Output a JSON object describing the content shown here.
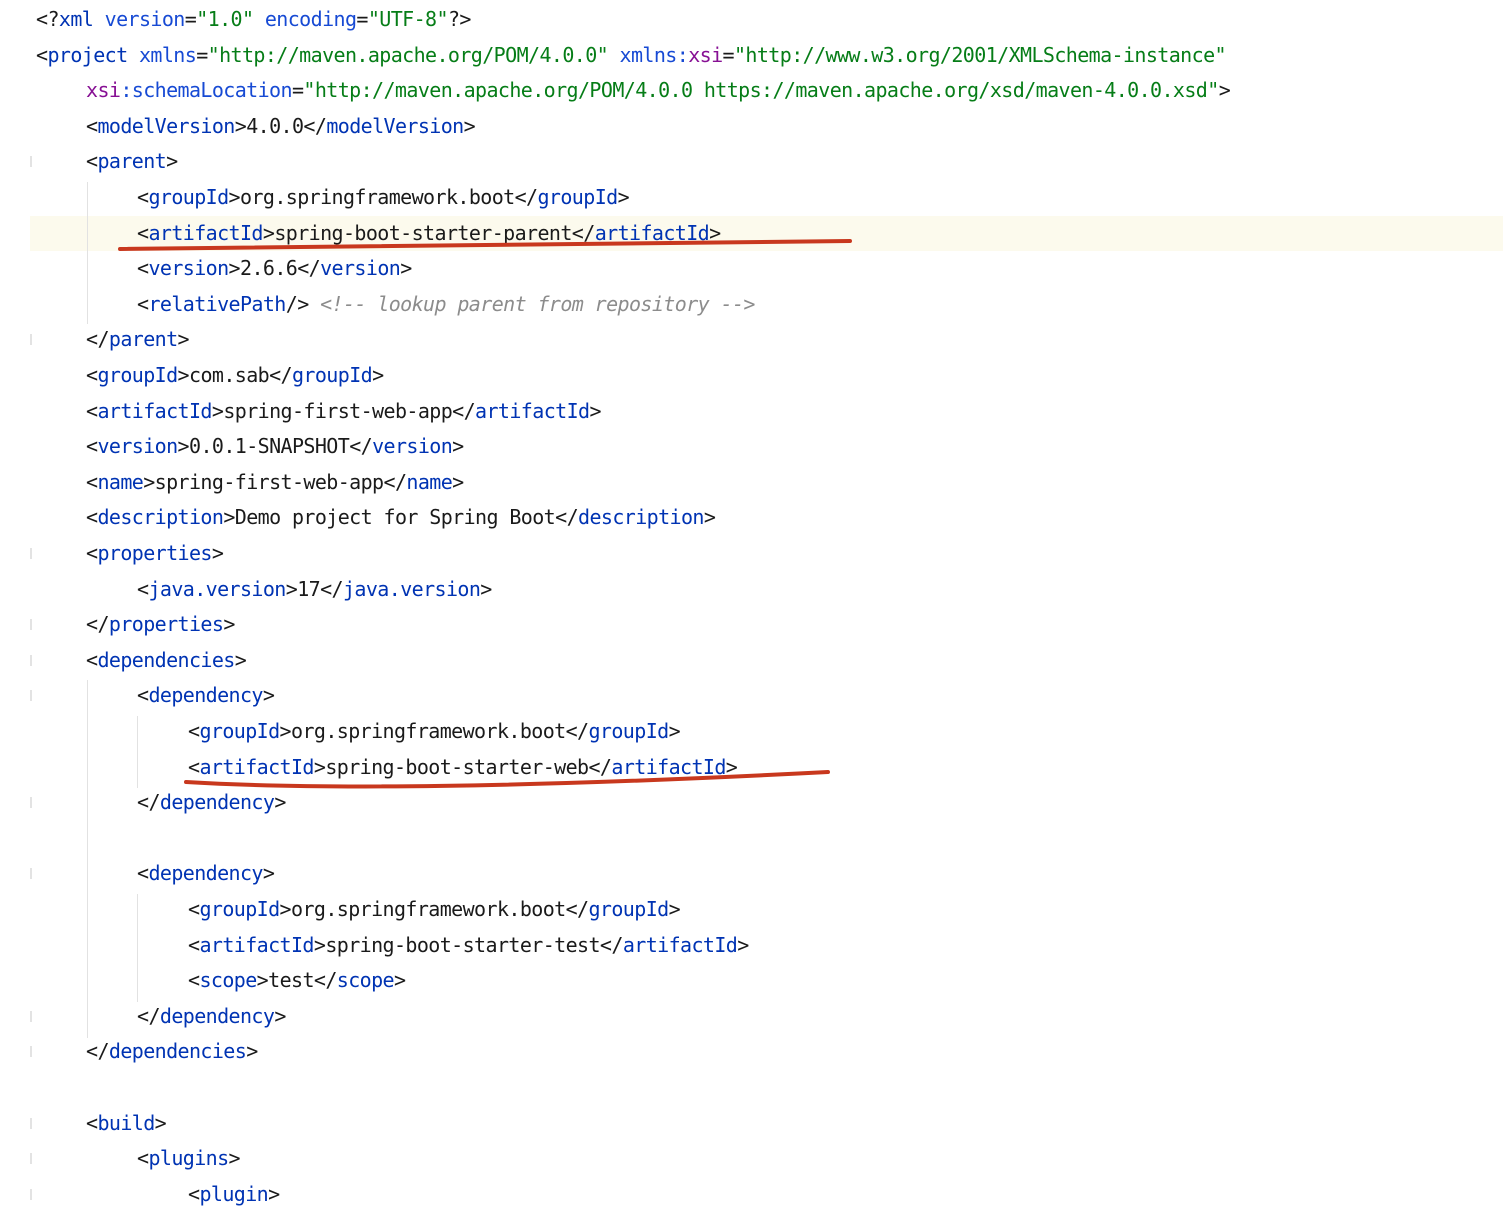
{
  "editor": {
    "current_line": 6,
    "lines": [
      {
        "indent": 0,
        "gutter": false,
        "tokens": [
          [
            "pun",
            "<?"
          ],
          [
            "tag",
            "xml "
          ],
          [
            "attr",
            "version"
          ],
          [
            "pun",
            "="
          ],
          [
            "val",
            "\"1.0\" "
          ],
          [
            "attr",
            "encoding"
          ],
          [
            "pun",
            "="
          ],
          [
            "val",
            "\"UTF-8\""
          ],
          [
            "pun",
            "?>"
          ]
        ]
      },
      {
        "indent": 0,
        "gutter": false,
        "tokens": [
          [
            "pun",
            "<"
          ],
          [
            "tag",
            "project "
          ],
          [
            "attr",
            "xmlns"
          ],
          [
            "pun",
            "="
          ],
          [
            "val",
            "\"http://maven.apache.org/POM/4.0.0\" "
          ],
          [
            "attr",
            "xmlns:"
          ],
          [
            "ns",
            "xsi"
          ],
          [
            "pun",
            "="
          ],
          [
            "val",
            "\"http://www.w3.org/2001/XMLSchema-instance\""
          ]
        ]
      },
      {
        "indent": 1,
        "gutter": false,
        "tokens": [
          [
            "ns",
            "xsi"
          ],
          [
            "attr",
            ":schemaLocation"
          ],
          [
            "pun",
            "="
          ],
          [
            "val",
            "\"http://maven.apache.org/POM/4.0.0 https://maven.apache.org/xsd/maven-4.0.0.xsd\""
          ],
          [
            "pun",
            ">"
          ]
        ]
      },
      {
        "indent": 1,
        "gutter": false,
        "tokens": [
          [
            "pun",
            "<"
          ],
          [
            "tag",
            "modelVersion"
          ],
          [
            "pun",
            ">"
          ],
          [
            "txt",
            "4.0.0"
          ],
          [
            "pun",
            "</"
          ],
          [
            "tag",
            "modelVersion"
          ],
          [
            "pun",
            ">"
          ]
        ]
      },
      {
        "indent": 1,
        "gutter": true,
        "tokens": [
          [
            "pun",
            "<"
          ],
          [
            "tag",
            "parent"
          ],
          [
            "pun",
            ">"
          ]
        ]
      },
      {
        "indent": 2,
        "gutter": false,
        "tokens": [
          [
            "pun",
            "<"
          ],
          [
            "tag",
            "groupId"
          ],
          [
            "pun",
            ">"
          ],
          [
            "txt",
            "org.springframework.boot"
          ],
          [
            "pun",
            "</"
          ],
          [
            "tag",
            "groupId"
          ],
          [
            "pun",
            ">"
          ]
        ]
      },
      {
        "indent": 2,
        "gutter": false,
        "tokens": [
          [
            "pun",
            "<"
          ],
          [
            "tag",
            "artifactId"
          ],
          [
            "pun",
            ">"
          ],
          [
            "txt",
            "spring-boot-starter-parent"
          ],
          [
            "pun",
            "</"
          ],
          [
            "tag",
            "artifactId"
          ],
          [
            "pun",
            ">"
          ]
        ]
      },
      {
        "indent": 2,
        "gutter": false,
        "tokens": [
          [
            "pun",
            "<"
          ],
          [
            "tag",
            "version"
          ],
          [
            "pun",
            ">"
          ],
          [
            "txt",
            "2.6.6"
          ],
          [
            "pun",
            "</"
          ],
          [
            "tag",
            "version"
          ],
          [
            "pun",
            ">"
          ]
        ]
      },
      {
        "indent": 2,
        "gutter": false,
        "tokens": [
          [
            "pun",
            "<"
          ],
          [
            "tag",
            "relativePath"
          ],
          [
            "pun",
            "/> "
          ],
          [
            "cmt",
            "<!-- lookup parent from repository -->"
          ]
        ]
      },
      {
        "indent": 1,
        "gutter": true,
        "tokens": [
          [
            "pun",
            "</"
          ],
          [
            "tag",
            "parent"
          ],
          [
            "pun",
            ">"
          ]
        ]
      },
      {
        "indent": 1,
        "gutter": false,
        "tokens": [
          [
            "pun",
            "<"
          ],
          [
            "tag",
            "groupId"
          ],
          [
            "pun",
            ">"
          ],
          [
            "txt",
            "com.sab"
          ],
          [
            "pun",
            "</"
          ],
          [
            "tag",
            "groupId"
          ],
          [
            "pun",
            ">"
          ]
        ]
      },
      {
        "indent": 1,
        "gutter": false,
        "tokens": [
          [
            "pun",
            "<"
          ],
          [
            "tag",
            "artifactId"
          ],
          [
            "pun",
            ">"
          ],
          [
            "txt",
            "spring-first-web-app"
          ],
          [
            "pun",
            "</"
          ],
          [
            "tag",
            "artifactId"
          ],
          [
            "pun",
            ">"
          ]
        ]
      },
      {
        "indent": 1,
        "gutter": false,
        "tokens": [
          [
            "pun",
            "<"
          ],
          [
            "tag",
            "version"
          ],
          [
            "pun",
            ">"
          ],
          [
            "txt",
            "0.0.1-SNAPSHOT"
          ],
          [
            "pun",
            "</"
          ],
          [
            "tag",
            "version"
          ],
          [
            "pun",
            ">"
          ]
        ]
      },
      {
        "indent": 1,
        "gutter": false,
        "tokens": [
          [
            "pun",
            "<"
          ],
          [
            "tag",
            "name"
          ],
          [
            "pun",
            ">"
          ],
          [
            "txt",
            "spring-first-web-app"
          ],
          [
            "pun",
            "</"
          ],
          [
            "tag",
            "name"
          ],
          [
            "pun",
            ">"
          ]
        ]
      },
      {
        "indent": 1,
        "gutter": false,
        "tokens": [
          [
            "pun",
            "<"
          ],
          [
            "tag",
            "description"
          ],
          [
            "pun",
            ">"
          ],
          [
            "txt",
            "Demo project for Spring Boot"
          ],
          [
            "pun",
            "</"
          ],
          [
            "tag",
            "description"
          ],
          [
            "pun",
            ">"
          ]
        ]
      },
      {
        "indent": 1,
        "gutter": true,
        "tokens": [
          [
            "pun",
            "<"
          ],
          [
            "tag",
            "properties"
          ],
          [
            "pun",
            ">"
          ]
        ]
      },
      {
        "indent": 2,
        "gutter": false,
        "tokens": [
          [
            "pun",
            "<"
          ],
          [
            "tag",
            "java.version"
          ],
          [
            "pun",
            ">"
          ],
          [
            "txt",
            "17"
          ],
          [
            "pun",
            "</"
          ],
          [
            "tag",
            "java.version"
          ],
          [
            "pun",
            ">"
          ]
        ]
      },
      {
        "indent": 1,
        "gutter": true,
        "tokens": [
          [
            "pun",
            "</"
          ],
          [
            "tag",
            "properties"
          ],
          [
            "pun",
            ">"
          ]
        ]
      },
      {
        "indent": 1,
        "gutter": true,
        "tokens": [
          [
            "pun",
            "<"
          ],
          [
            "tag",
            "dependencies"
          ],
          [
            "pun",
            ">"
          ]
        ]
      },
      {
        "indent": 2,
        "gutter": true,
        "tokens": [
          [
            "pun",
            "<"
          ],
          [
            "tag",
            "dependency"
          ],
          [
            "pun",
            ">"
          ]
        ]
      },
      {
        "indent": 3,
        "gutter": false,
        "tokens": [
          [
            "pun",
            "<"
          ],
          [
            "tag",
            "groupId"
          ],
          [
            "pun",
            ">"
          ],
          [
            "txt",
            "org.springframework.boot"
          ],
          [
            "pun",
            "</"
          ],
          [
            "tag",
            "groupId"
          ],
          [
            "pun",
            ">"
          ]
        ]
      },
      {
        "indent": 3,
        "gutter": false,
        "tokens": [
          [
            "pun",
            "<"
          ],
          [
            "tag",
            "artifactId"
          ],
          [
            "pun",
            ">"
          ],
          [
            "txt",
            "spring-boot-starter-web"
          ],
          [
            "pun",
            "</"
          ],
          [
            "tag",
            "artifactId"
          ],
          [
            "pun",
            ">"
          ]
        ]
      },
      {
        "indent": 2,
        "gutter": true,
        "tokens": [
          [
            "pun",
            "</"
          ],
          [
            "tag",
            "dependency"
          ],
          [
            "pun",
            ">"
          ]
        ]
      },
      {
        "indent": 0,
        "gutter": false,
        "tokens": []
      },
      {
        "indent": 2,
        "gutter": true,
        "tokens": [
          [
            "pun",
            "<"
          ],
          [
            "tag",
            "dependency"
          ],
          [
            "pun",
            ">"
          ]
        ]
      },
      {
        "indent": 3,
        "gutter": false,
        "tokens": [
          [
            "pun",
            "<"
          ],
          [
            "tag",
            "groupId"
          ],
          [
            "pun",
            ">"
          ],
          [
            "txt",
            "org.springframework.boot"
          ],
          [
            "pun",
            "</"
          ],
          [
            "tag",
            "groupId"
          ],
          [
            "pun",
            ">"
          ]
        ]
      },
      {
        "indent": 3,
        "gutter": false,
        "tokens": [
          [
            "pun",
            "<"
          ],
          [
            "tag",
            "artifactId"
          ],
          [
            "pun",
            ">"
          ],
          [
            "txt",
            "spring-boot-starter-test"
          ],
          [
            "pun",
            "</"
          ],
          [
            "tag",
            "artifactId"
          ],
          [
            "pun",
            ">"
          ]
        ]
      },
      {
        "indent": 3,
        "gutter": false,
        "tokens": [
          [
            "pun",
            "<"
          ],
          [
            "tag",
            "scope"
          ],
          [
            "pun",
            ">"
          ],
          [
            "txt",
            "test"
          ],
          [
            "pun",
            "</"
          ],
          [
            "tag",
            "scope"
          ],
          [
            "pun",
            ">"
          ]
        ]
      },
      {
        "indent": 2,
        "gutter": true,
        "tokens": [
          [
            "pun",
            "</"
          ],
          [
            "tag",
            "dependency"
          ],
          [
            "pun",
            ">"
          ]
        ]
      },
      {
        "indent": 1,
        "gutter": true,
        "tokens": [
          [
            "pun",
            "</"
          ],
          [
            "tag",
            "dependencies"
          ],
          [
            "pun",
            ">"
          ]
        ]
      },
      {
        "indent": 0,
        "gutter": false,
        "tokens": []
      },
      {
        "indent": 1,
        "gutter": true,
        "tokens": [
          [
            "pun",
            "<"
          ],
          [
            "tag",
            "build"
          ],
          [
            "pun",
            ">"
          ]
        ]
      },
      {
        "indent": 2,
        "gutter": true,
        "tokens": [
          [
            "pun",
            "<"
          ],
          [
            "tag",
            "plugins"
          ],
          [
            "pun",
            ">"
          ]
        ]
      },
      {
        "indent": 3,
        "gutter": true,
        "tokens": [
          [
            "pun",
            "<"
          ],
          [
            "tag",
            "plugin"
          ],
          [
            "pun",
            ">"
          ]
        ]
      }
    ]
  },
  "annotations": {
    "underline_color": "#c8381e",
    "underlined_lines": [
      6,
      21
    ]
  }
}
